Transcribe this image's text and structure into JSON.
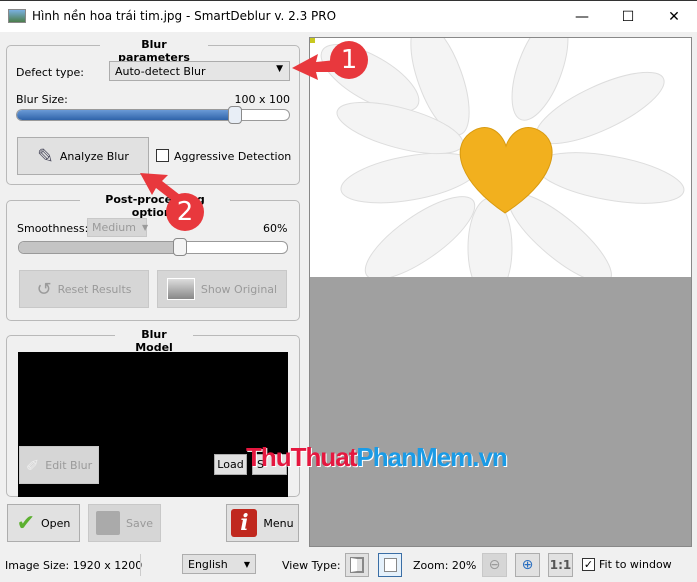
{
  "window": {
    "title": "Hình nền hoa trái tim.jpg - SmartDeblur v. 2.3 PRO",
    "minimize": "—",
    "maximize": "☐",
    "close": "✕"
  },
  "blur_parameters": {
    "title": "Blur parameters",
    "defect_label": "Defect type:",
    "defect_value": "Auto-detect Blur",
    "blur_size_label": "Blur Size:",
    "blur_size_value": "100 x 100",
    "blur_slider_percent": 80,
    "analyze_label": "Analyze Blur",
    "aggressive_label": "Aggressive Detection",
    "aggressive_checked": false
  },
  "post_processing": {
    "title": "Post-processing options",
    "smoothness_label": "Smoothness:",
    "smoothness_value": "Medium",
    "smoothness_percent": "60%",
    "smoothness_slider_percent": 60,
    "reset_label": "Reset Results",
    "show_original_label": "Show Original"
  },
  "blur_model": {
    "title": "Blur Model",
    "edit_label": "Edit Blur",
    "load_label": "Load",
    "save_label": "S"
  },
  "actions": {
    "open": "Open",
    "save": "Save",
    "menu": "Menu"
  },
  "status": {
    "image_size": "Image Size: 1920 x 1200",
    "language": "English",
    "view_type_label": "View Type:",
    "zoom": "Zoom: 20%",
    "one_to_one": "1:1",
    "fit_label": "Fit to window",
    "fit_checked": true
  },
  "callouts": [
    "1",
    "2"
  ],
  "watermark": {
    "part1": "ThuThuat",
    "part2": "PhanMem.vn"
  },
  "colors": {
    "accent_red": "#e8383d",
    "slider_blue": "#3c78c0",
    "viewer_bg": "#a0a0a0"
  }
}
